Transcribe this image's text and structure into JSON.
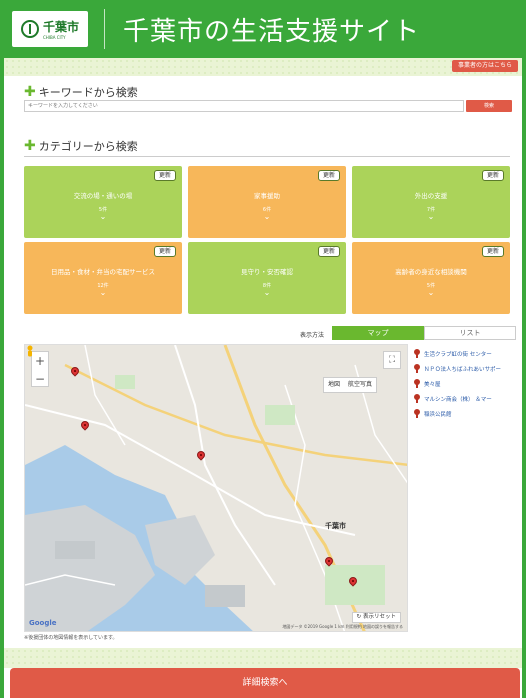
{
  "header": {
    "logo_text": "千葉市",
    "logo_sub": "CHIBA CITY",
    "title": "千葉市の生活支援サイト"
  },
  "subbar": {
    "business_button": "事業者の方はこちら"
  },
  "keyword_search": {
    "title": "キーワードから検索",
    "placeholder": "キーワードを入力してください",
    "button": "検索"
  },
  "category_search": {
    "title": "カテゴリーから検索",
    "cards": [
      {
        "title": "交流の場・通いの場",
        "count": "5件",
        "badge": "更新",
        "color": "green"
      },
      {
        "title": "家事援助",
        "count": "6件",
        "badge": "更新",
        "color": "orange"
      },
      {
        "title": "外出の支援",
        "count": "7件",
        "badge": "更新",
        "color": "green"
      },
      {
        "title": "日用品・食材・弁当の宅配サービス",
        "count": "12件",
        "badge": "更新",
        "color": "orange"
      },
      {
        "title": "見守り・安否確認",
        "count": "8件",
        "badge": "更新",
        "color": "green"
      },
      {
        "title": "高齢者の身近な相談機関",
        "count": "5件",
        "badge": "更新",
        "color": "orange"
      }
    ]
  },
  "display_mode": {
    "label": "表示方法",
    "map_tab": "マップ",
    "list_tab": "リスト"
  },
  "map": {
    "zoom_in": "+",
    "zoom_out": "−",
    "type_map": "地図",
    "type_satellite": "航空写真",
    "reset": "表示リセット",
    "google": "Google",
    "attribution": "地図データ ©2019 Google 1 km  利用規約  地図の誤りを報告する",
    "city_label": "千葉市",
    "note": "※後援団体の地図情報を表示しています。"
  },
  "places": [
    "生活クラブ虹の街 センター",
    "ＮＰＯ法人ちばふれあいサポー",
    "美々屋",
    "マルシン商会（株） ＆マー",
    "稲浜公民館"
  ],
  "detail_button": "詳細検索へ",
  "colors": {
    "brand_green": "#3aa83a",
    "accent_red": "#e05a47",
    "card_green": "#abd35a",
    "card_orange": "#f7b75a"
  }
}
